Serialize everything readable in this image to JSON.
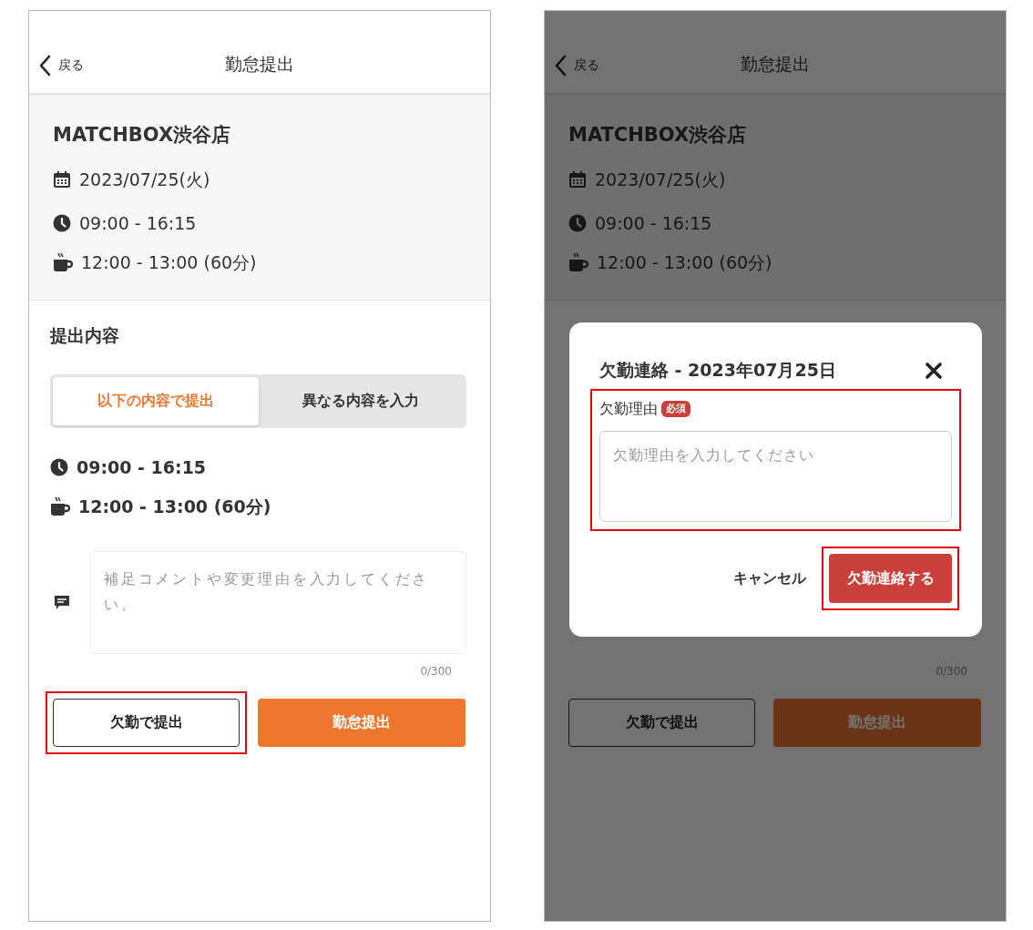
{
  "screens": [
    {
      "header": {
        "back_label": "戻る",
        "title": "勤怠提出"
      },
      "shift": {
        "store": "MATCHBOX渋谷店",
        "date": "2023/07/25(火)",
        "time": "09:00 - 16:15",
        "break": "12:00 - 13:00 (60分)"
      },
      "submission": {
        "heading": "提出内容",
        "tabs": [
          {
            "label": "以下の内容で提出",
            "selected": true
          },
          {
            "label": "異なる内容を入力",
            "selected": false
          }
        ],
        "time": "09:00 - 16:15",
        "break": "12:00 - 13:00 (60分)",
        "comment": {
          "placeholder": "補足コメントや変更理由を入力してください。"
        }
      },
      "counter": "0/300",
      "buttons": [
        {
          "label": "欠勤で提出",
          "kind": "outline",
          "highlighted": true
        },
        {
          "label": "勤怠提出",
          "kind": "primary",
          "highlighted": false
        }
      ]
    },
    {
      "header": {
        "back_label": "戻る",
        "title": "勤怠提出"
      },
      "shift": {
        "store": "MATCHBOX渋谷店",
        "date": "2023/07/25(火)",
        "time": "09:00 - 16:15",
        "break": "12:00 - 13:00 (60分)"
      },
      "counter": "0/300",
      "buttons": [
        {
          "label": "欠勤で提出",
          "kind": "outline",
          "highlighted": false
        },
        {
          "label": "勤怠提出",
          "kind": "primary",
          "highlighted": false
        }
      ],
      "dialog": {
        "title": "欠勤連絡 - 2023年07月25日",
        "field": {
          "label": "欠勤理由",
          "badge": "必須",
          "placeholder": "欠勤理由を入力してください",
          "highlighted": true
        },
        "actions": [
          {
            "label": "キャンセル",
            "kind": "text",
            "highlighted": false
          },
          {
            "label": "欠勤連絡する",
            "kind": "danger",
            "highlighted": true
          }
        ]
      }
    }
  ]
}
